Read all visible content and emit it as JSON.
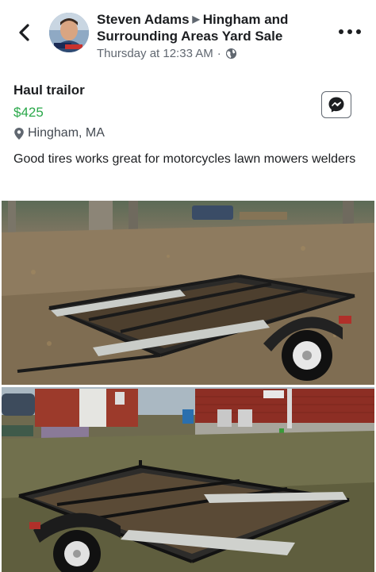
{
  "post": {
    "author": "Steven Adams",
    "group": "Hingham and Surrounding Areas Yard Sale",
    "timestamp": "Thursday at 12:33 AM",
    "separator": "·"
  },
  "listing": {
    "title": "Haul trailor",
    "price": "$425",
    "location": "Hingham, MA",
    "description": "Good tires   works great for motorcycles lawn mowers welders"
  },
  "colors": {
    "price": "#2aa84a",
    "text": "#1c1e21",
    "secondary": "#606770"
  },
  "icons": {
    "back": "chevron-left-icon",
    "privacy": "globe-icon",
    "more": "more-dots-icon",
    "messenger": "messenger-icon",
    "location": "map-pin-icon"
  }
}
